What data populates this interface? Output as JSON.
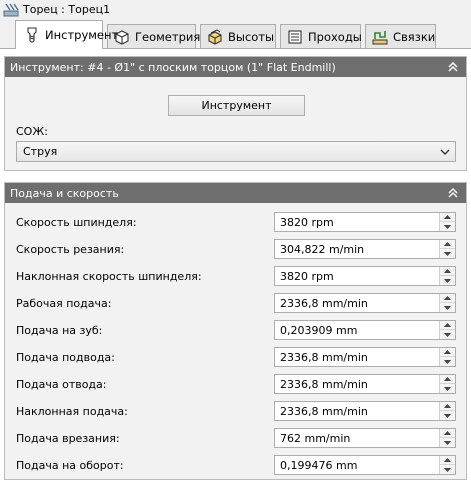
{
  "window": {
    "title": "Торец : Торец1",
    "icon": "facing-operation-icon"
  },
  "tabs": [
    {
      "label": "Инструмент",
      "icon": "tool-icon",
      "active": true
    },
    {
      "label": "Геометрия",
      "icon": "geometry-cube-icon",
      "active": false
    },
    {
      "label": "Высоты",
      "icon": "heights-box-icon",
      "active": false
    },
    {
      "label": "Проходы",
      "icon": "passes-icon",
      "active": false
    },
    {
      "label": "Связки",
      "icon": "linking-icon",
      "active": false
    }
  ],
  "tool_section": {
    "header": "Инструмент: #4 - Ø1\" с плоским торцом (1\" Flat Endmill)",
    "tool_button": "Инструмент",
    "coolant_label": "СОЖ:",
    "coolant_value": "Струя"
  },
  "feed_section": {
    "header": "Подача и скорость",
    "rows": [
      {
        "label": "Скорость шпинделя:",
        "value": "3820 rpm"
      },
      {
        "label": "Скорость резания:",
        "value": "304,822 m/min"
      },
      {
        "label": "Наклонная скорость шпинделя:",
        "value": "3820 rpm"
      },
      {
        "label": "Рабочая подача:",
        "value": "2336,8 mm/min"
      },
      {
        "label": "Подача на зуб:",
        "value": "0,203909 mm"
      },
      {
        "label": "Подача подвода:",
        "value": "2336,8 mm/min"
      },
      {
        "label": "Подача отвода:",
        "value": "2336,8 mm/min"
      },
      {
        "label": "Наклонная подача:",
        "value": "2336,8 mm/min"
      },
      {
        "label": "Подача врезания:",
        "value": "762 mm/min"
      },
      {
        "label": "Подача на оборот:",
        "value": "0,199476 mm"
      }
    ]
  },
  "colors": {
    "section_header_bg": "#6e6e6e",
    "section_bg": "#f2f2f2",
    "window_bg": "#f0f0f0"
  }
}
